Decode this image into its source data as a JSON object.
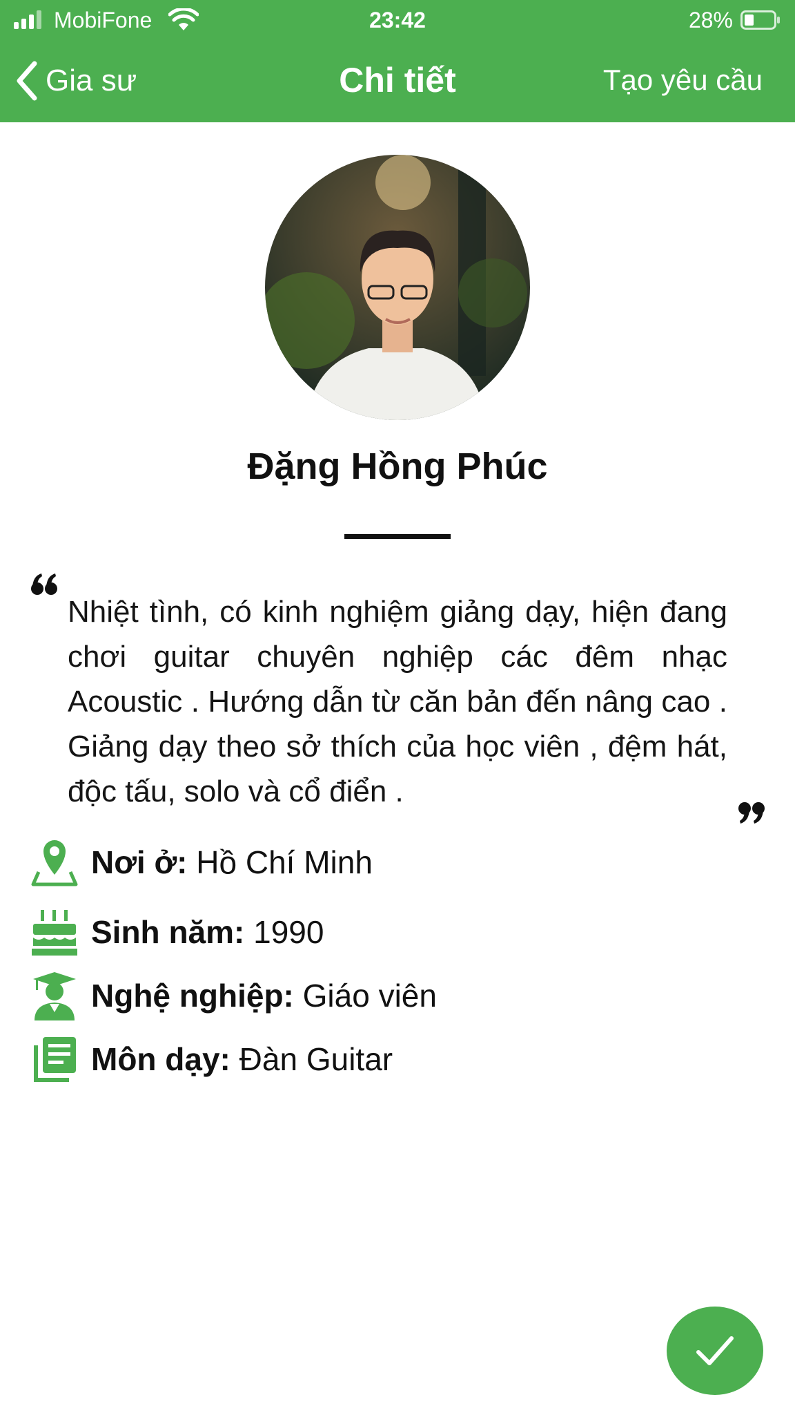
{
  "status_bar": {
    "carrier": "MobiFone",
    "time": "23:42",
    "battery": "28%"
  },
  "nav": {
    "back_label": "Gia sư",
    "title": "Chi tiết",
    "action_label": "Tạo yêu cầu"
  },
  "profile": {
    "name": "Đặng Hồng Phúc",
    "bio": "Nhiệt tình, có kinh nghiệm giảng dạy, hiện đang chơi guitar chuyên nghiệp các đêm nhạc Acoustic . Hướng dẫn từ căn bản đến nâng cao . Giảng dạy theo sở thích của học viên , đệm hát, độc tấu, solo và cổ điển ."
  },
  "details": [
    {
      "icon": "location-pin-icon",
      "label": "Nơi ở:",
      "value": "Hồ Chí Minh"
    },
    {
      "icon": "birthday-cake-icon",
      "label": "Sinh năm:",
      "value": "1990"
    },
    {
      "icon": "graduate-icon",
      "label": "Nghệ nghiệp:",
      "value": "Giáo viên"
    },
    {
      "icon": "subject-book-icon",
      "label": "Môn dạy:",
      "value": "Đàn Guitar"
    }
  ],
  "fab": {
    "icon": "checkmark-icon"
  },
  "colors": {
    "accent": "#4caf50",
    "text": "#111111",
    "background": "#ffffff"
  }
}
